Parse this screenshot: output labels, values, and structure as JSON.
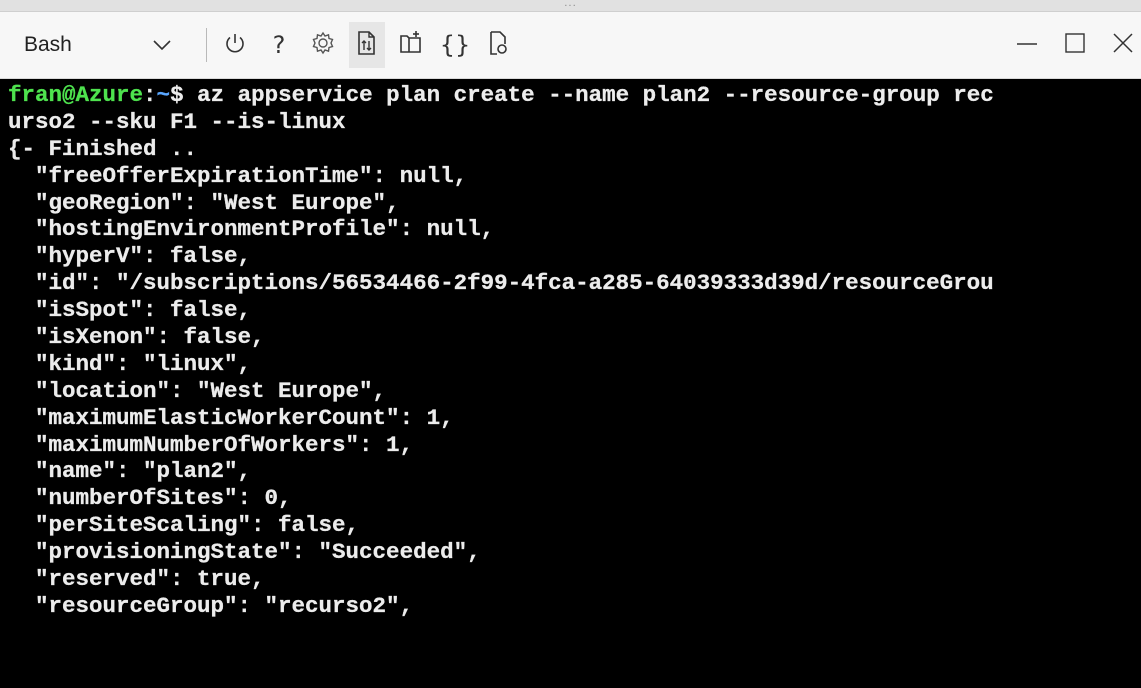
{
  "window": {
    "grip": "...",
    "controls": {
      "minimize_icon": "minimize-icon",
      "maximize_icon": "maximize-icon",
      "close_icon": "close-icon"
    }
  },
  "toolbar": {
    "shell_selector": {
      "label": "Bash",
      "icon": "chevron-down-icon"
    },
    "buttons": [
      {
        "name": "restart-button",
        "icon": "power-icon"
      },
      {
        "name": "help-button",
        "icon": "question-icon",
        "glyph": "?"
      },
      {
        "name": "settings-button",
        "icon": "gear-icon"
      },
      {
        "name": "upload-download-button",
        "icon": "upload-download-icon"
      },
      {
        "name": "new-session-button",
        "icon": "new-session-icon"
      },
      {
        "name": "editor-button",
        "icon": "braces-icon",
        "glyph": "{}"
      },
      {
        "name": "web-preview-button",
        "icon": "web-preview-icon"
      }
    ],
    "accent_icon_color": "#333333"
  },
  "terminal": {
    "background": "#000000",
    "prompt_user_color": "#4ee24e",
    "prompt_path_color": "#5aa7ff",
    "text_color": "#ececec",
    "prompt": {
      "user": "fran@Azure",
      "sep": ":",
      "path": "~",
      "symbol": "$ ",
      "command": "az appservice plan create --name plan2 --resource-group rec"
    },
    "lines": [
      "urso2 --sku F1 --is-linux",
      "{- Finished ..",
      "  \"freeOfferExpirationTime\": null,",
      "  \"geoRegion\": \"West Europe\",",
      "  \"hostingEnvironmentProfile\": null,",
      "  \"hyperV\": false,",
      "  \"id\": \"/subscriptions/56534466-2f99-4fca-a285-64039333d39d/resourceGrou",
      "  \"isSpot\": false,",
      "  \"isXenon\": false,",
      "  \"kind\": \"linux\",",
      "  \"location\": \"West Europe\",",
      "  \"maximumElasticWorkerCount\": 1,",
      "  \"maximumNumberOfWorkers\": 1,",
      "  \"name\": \"plan2\",",
      "  \"numberOfSites\": 0,",
      "  \"perSiteScaling\": false,",
      "  \"provisioningState\": \"Succeeded\",",
      "  \"reserved\": true,",
      "  \"resourceGroup\": \"recurso2\","
    ]
  }
}
